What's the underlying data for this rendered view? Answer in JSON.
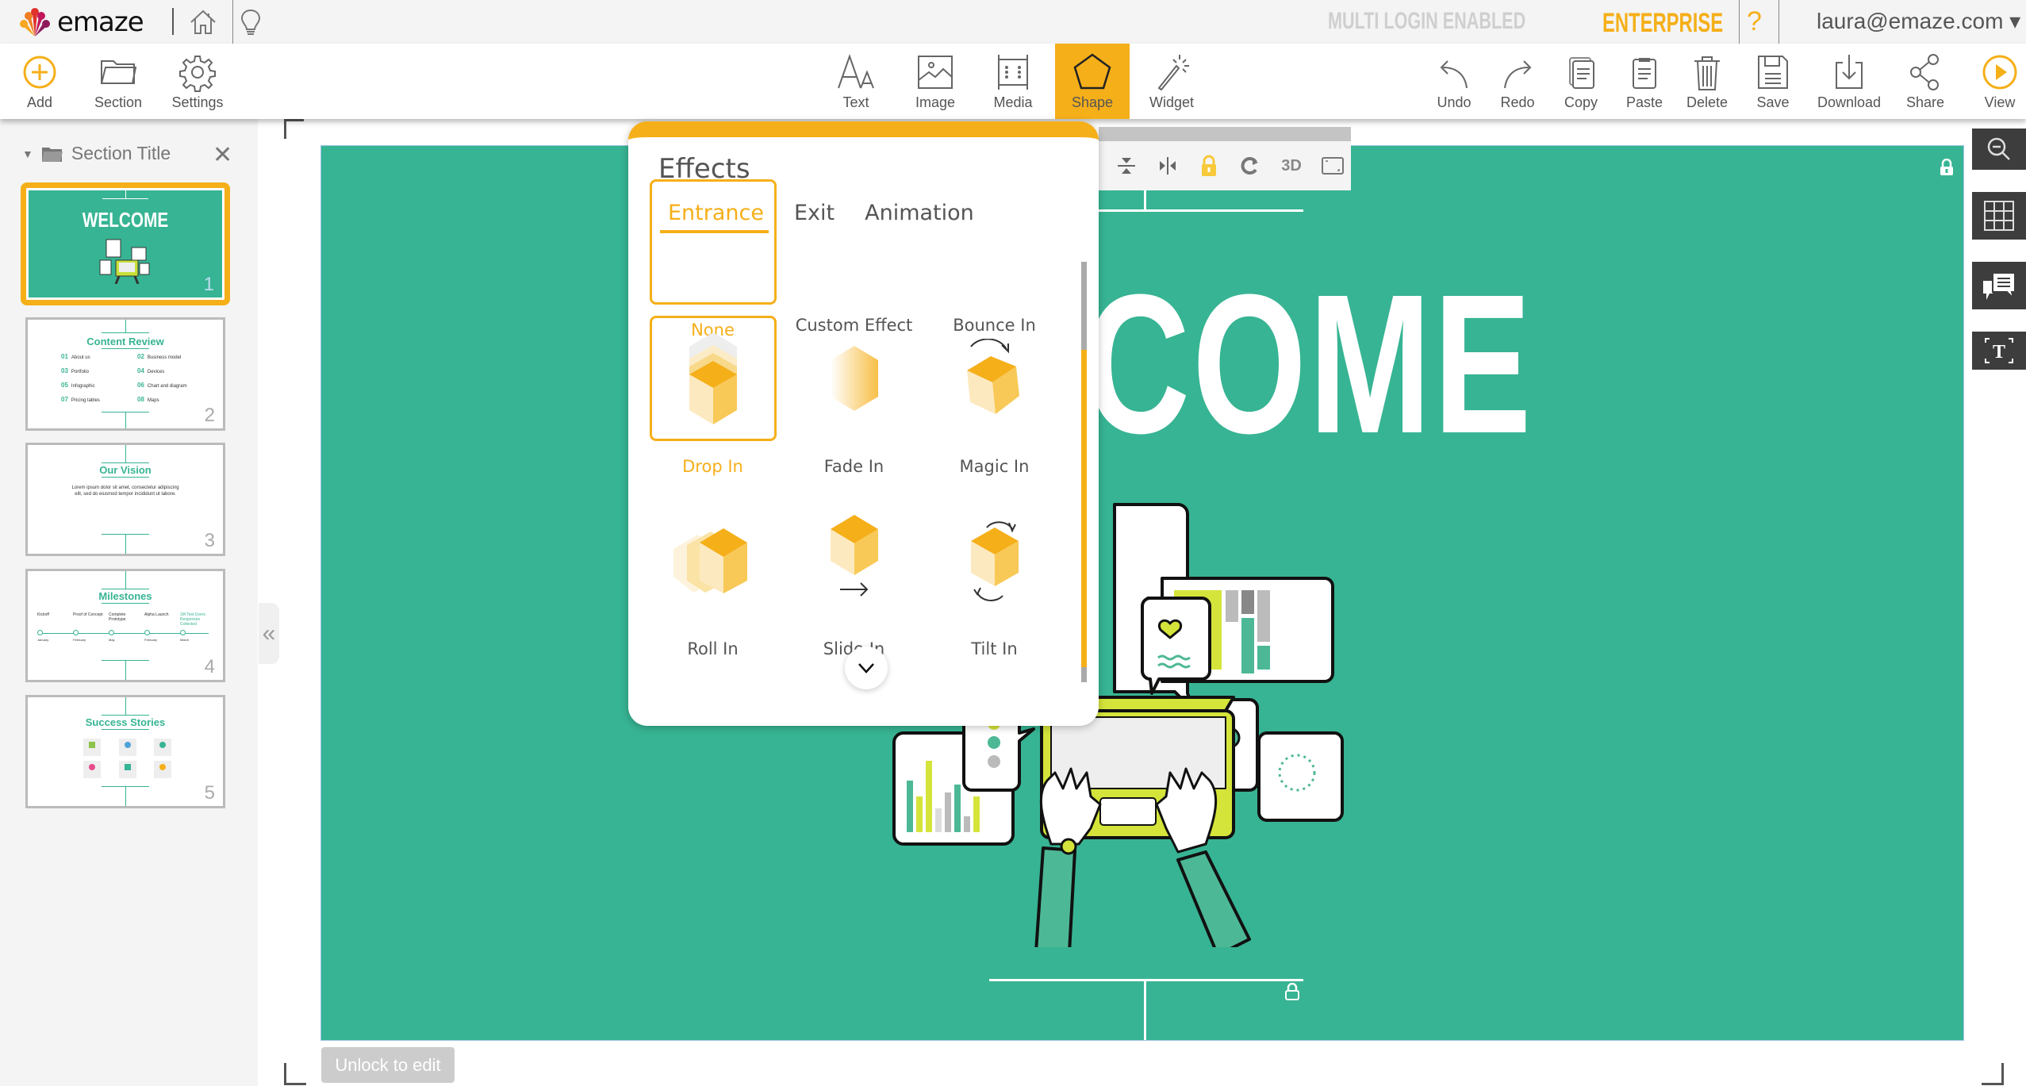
{
  "topbar": {
    "logo_text": "emaze",
    "multi_login": "MULTI LOGIN ENABLED",
    "plan": "ENTERPRISE",
    "help": "?",
    "user_email": "laura@emaze.com ▾"
  },
  "toolbar": {
    "left": [
      {
        "label": "Add",
        "icon": "add-icon"
      },
      {
        "label": "Section",
        "icon": "folder-icon"
      },
      {
        "label": "Settings",
        "icon": "gear-icon"
      }
    ],
    "center": [
      {
        "label": "Text",
        "icon": "text-icon"
      },
      {
        "label": "Image",
        "icon": "image-icon"
      },
      {
        "label": "Media",
        "icon": "media-icon"
      },
      {
        "label": "Shape",
        "icon": "pentagon-icon",
        "active": true
      },
      {
        "label": "Widget",
        "icon": "magic-wand-icon"
      }
    ],
    "right": [
      {
        "label": "Undo",
        "icon": "undo-icon"
      },
      {
        "label": "Redo",
        "icon": "redo-icon"
      },
      {
        "label": "Copy",
        "icon": "copy-icon"
      },
      {
        "label": "Paste",
        "icon": "paste-icon"
      },
      {
        "label": "Delete",
        "icon": "trash-icon"
      },
      {
        "label": "Save",
        "icon": "save-icon"
      },
      {
        "label": "Download",
        "icon": "download-icon"
      },
      {
        "label": "Share",
        "icon": "share-icon"
      },
      {
        "label": "View",
        "icon": "play-icon"
      }
    ]
  },
  "sidebar": {
    "section_title": "Section Title",
    "close": "✕",
    "collapse": "«",
    "slides": [
      {
        "num": "1",
        "title": "WELCOME",
        "active": true
      },
      {
        "num": "2",
        "title": "Content Review",
        "items": [
          {
            "n": "01",
            "t": "About us"
          },
          {
            "n": "02",
            "t": "Business model"
          },
          {
            "n": "03",
            "t": "Portfolio"
          },
          {
            "n": "04",
            "t": "Devices"
          },
          {
            "n": "05",
            "t": "Infographic"
          },
          {
            "n": "06",
            "t": "Chart and diagram"
          },
          {
            "n": "07",
            "t": "Pricing tables"
          },
          {
            "n": "08",
            "t": "Maps"
          }
        ]
      },
      {
        "num": "3",
        "title": "Our Vision",
        "body": "Lorem ipsum dolor sit amet, consectetur adipiscing elit, sed do eiusmod tempor incididunt ut labore."
      },
      {
        "num": "4",
        "title": "Milestones",
        "milestones": [
          {
            "label": "Kickoff",
            "month": "January"
          },
          {
            "label": "Proof of Concept",
            "month": "February"
          },
          {
            "label": "Complete Prototype",
            "month": "May"
          },
          {
            "label": "Alpha Launch",
            "month": "February"
          },
          {
            "label": "1M Test Users Responses Collected",
            "month": "March"
          }
        ]
      },
      {
        "num": "5",
        "title": "Success Stories"
      }
    ]
  },
  "canvas": {
    "headline": "WELCOME",
    "unlock_button": "Unlock to edit"
  },
  "mini_toolbar": {
    "items": [
      "align-vertical-icon",
      "align-horizontal-icon",
      "lock-icon",
      "rotate-icon",
      "3d-icon",
      "crop-icon"
    ],
    "label_3d": "3D"
  },
  "effects": {
    "title": "Effects",
    "tabs": [
      {
        "label": "Entrance",
        "active": true
      },
      {
        "label": "Exit"
      },
      {
        "label": "Animation"
      }
    ],
    "options": [
      {
        "label": "None"
      },
      {
        "label": "Custom Effect"
      },
      {
        "label": "Bounce In"
      },
      {
        "label": "Drop In",
        "selected": true
      },
      {
        "label": "Fade In"
      },
      {
        "label": "Magic In"
      },
      {
        "label": "Roll In"
      },
      {
        "label": "Slide In"
      },
      {
        "label": "Tilt In"
      }
    ],
    "scroll_fraction": 0.2
  },
  "right_tools": [
    "zoom-out-icon",
    "grid-icon",
    "comments-icon",
    "text-frame-icon"
  ],
  "colors": {
    "accent": "#f5af19",
    "slide_bg": "#37b493",
    "dark_tool": "#3d3d3d"
  }
}
